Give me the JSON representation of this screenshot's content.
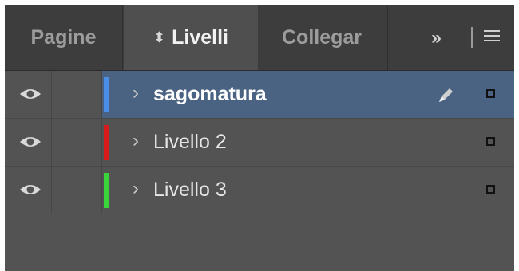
{
  "tabs": {
    "pagine": "Pagine",
    "livelli": "Livelli",
    "collegamenti": "Collegar"
  },
  "icons": {
    "tab_updown": "updown-arrow-icon",
    "overflow": "double-chevron-icon",
    "panel_menu": "hamburger-menu-icon",
    "visibility": "eye-icon",
    "expand": "chevron-right-icon",
    "current_drawing_layer": "pen-icon",
    "selection": "square-icon"
  },
  "layers": [
    {
      "name": "sagomatura",
      "color": "#4a8ee8",
      "selected": true
    },
    {
      "name": "Livello 2",
      "color": "#d81a1a",
      "selected": false
    },
    {
      "name": "Livello 3",
      "color": "#39d43a",
      "selected": false
    }
  ],
  "colors": {
    "panel_bg": "#535353",
    "tabbar_bg": "#3d3d3d",
    "active_tab_bg": "#4f4f4f",
    "selected_row": "#4a6383"
  }
}
